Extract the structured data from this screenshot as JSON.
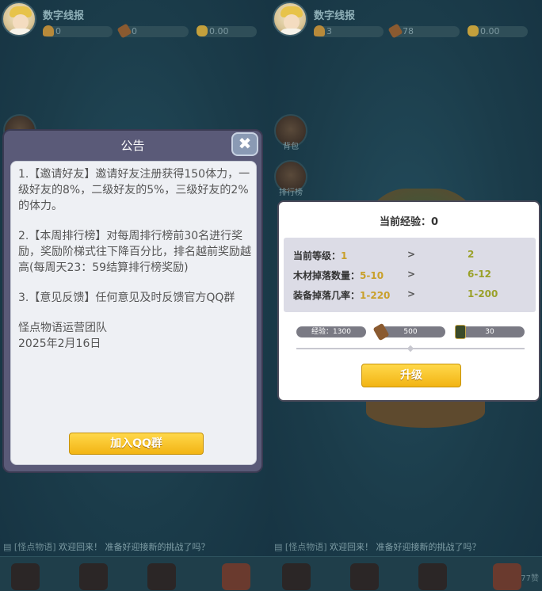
{
  "left_pane": {
    "player": {
      "name": "数字线报",
      "strength": "0",
      "wood": "0",
      "gold": "0.00"
    },
    "chat": {
      "tag": "[怪点物语]",
      "message": "欢迎回来！ 准备好迎接新的挑战了吗？"
    }
  },
  "right_pane": {
    "player": {
      "name": "数字线报",
      "strength": "3",
      "wood": "78",
      "gold": "0.00"
    },
    "side_buttons": {
      "bag": "背包",
      "ranking": "排行榜"
    },
    "chat": {
      "tag": "[怪点物语]",
      "message": "欢迎回来！ 准备好迎接新的挑战了吗？"
    },
    "watermark": "77赞"
  },
  "notice_dialog": {
    "title": "公告",
    "close_icon": "✖",
    "paragraphs": [
      "1.【邀请好友】邀请好友注册获得150体力，一级好友的8%，二级好友的5%，三级好友的2%的体力。",
      "2.【本周排行榜】对每周排行榜前30名进行奖励，奖励阶梯式往下降百分比，排名越前奖励越高(每周天23：59结算排行榜奖励)",
      "3.【意见反馈】任何意见及时反馈官方QQ群"
    ],
    "signature": "怪点物语运营团队",
    "date": "2025年2月16日",
    "join_button": "加入QQ群"
  },
  "upgrade_dialog": {
    "current_exp_label": "当前经验：",
    "current_exp_value": "0",
    "rows": [
      {
        "label": "当前等级：",
        "current": "1",
        "arrow": ">",
        "next": "2"
      },
      {
        "label": "木材掉落数量：",
        "current": "5-10",
        "arrow": ">",
        "next": "6-12"
      },
      {
        "label": "装备掉落几率：",
        "current": "1-220",
        "arrow": ">",
        "next": "1-200"
      }
    ],
    "cost": {
      "exp": "经验：1300",
      "wood": "500",
      "scroll": "30"
    },
    "upgrade_button": "升级"
  },
  "icons": [
    "close-icon",
    "strength-icon",
    "wood-icon",
    "gold-icon",
    "bag-icon",
    "ranking-icon",
    "chat-icon",
    "gift-icon"
  ],
  "colors": {
    "accent_yellow": "#f2b414",
    "dialog_frame": "#5a5a78",
    "background": "#1c3e4c"
  }
}
